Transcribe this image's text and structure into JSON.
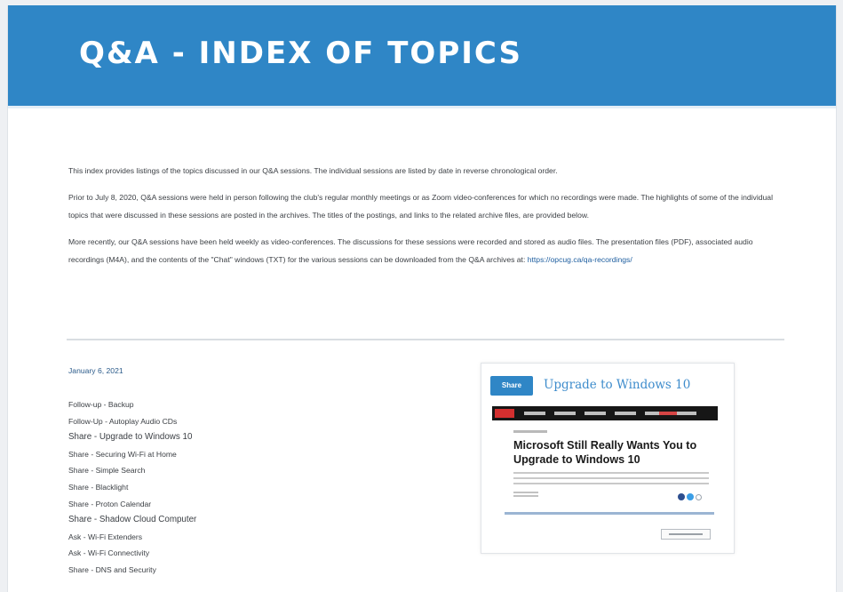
{
  "banner": {
    "title": "Q&A - INDEX OF TOPICS"
  },
  "intro": {
    "p1": "This index provides listings of the topics discussed in our Q&A sessions.  The individual sessions are listed by date in reverse chronological order.",
    "p2": "Prior to July 8, 2020, Q&A sessions were held in person following the club's regular monthly meetings or as Zoom video-conferences for which no recordings were made.  The highlights of some of the individual topics that were discussed in these sessions are posted in the archives. The titles of the postings, and links to the related archive files, are provided below.",
    "p3": "More recently, our Q&A sessions have been held weekly as video-conferences.  The discussions for these sessions were recorded and stored as audio files.  The presentation files (PDF), associated audio recordings (M4A), and the contents of the \"Chat\" windows (TXT) for the various sessions can be downloaded from the Q&A archives at:",
    "link": "https://opcug.ca/qa-recordings/"
  },
  "session": {
    "date": "January 6, 2021",
    "topics": [
      "Follow-up - Backup",
      "Follow-Up - Autoplay Audio CDs",
      "Share - Upgrade to Windows 10",
      "Share - Securing Wi-Fi at Home",
      "Share - Simple Search",
      "Share - Blacklight",
      "Share - Proton Calendar",
      "Share - Shadow Cloud Computer",
      "Ask - Wi-Fi Extenders",
      "Ask - Wi-Fi Connectivity",
      "Share - DNS and Security"
    ]
  },
  "share_card": {
    "badge": "Share",
    "heading": "Upgrade to Windows 10",
    "article_title": "Microsoft Still Really Wants You to Upgrade to Windows 10"
  },
  "colors": {
    "banner": "#2f86c6",
    "link": "#1f5fa0",
    "date": "#2b5b8a"
  }
}
